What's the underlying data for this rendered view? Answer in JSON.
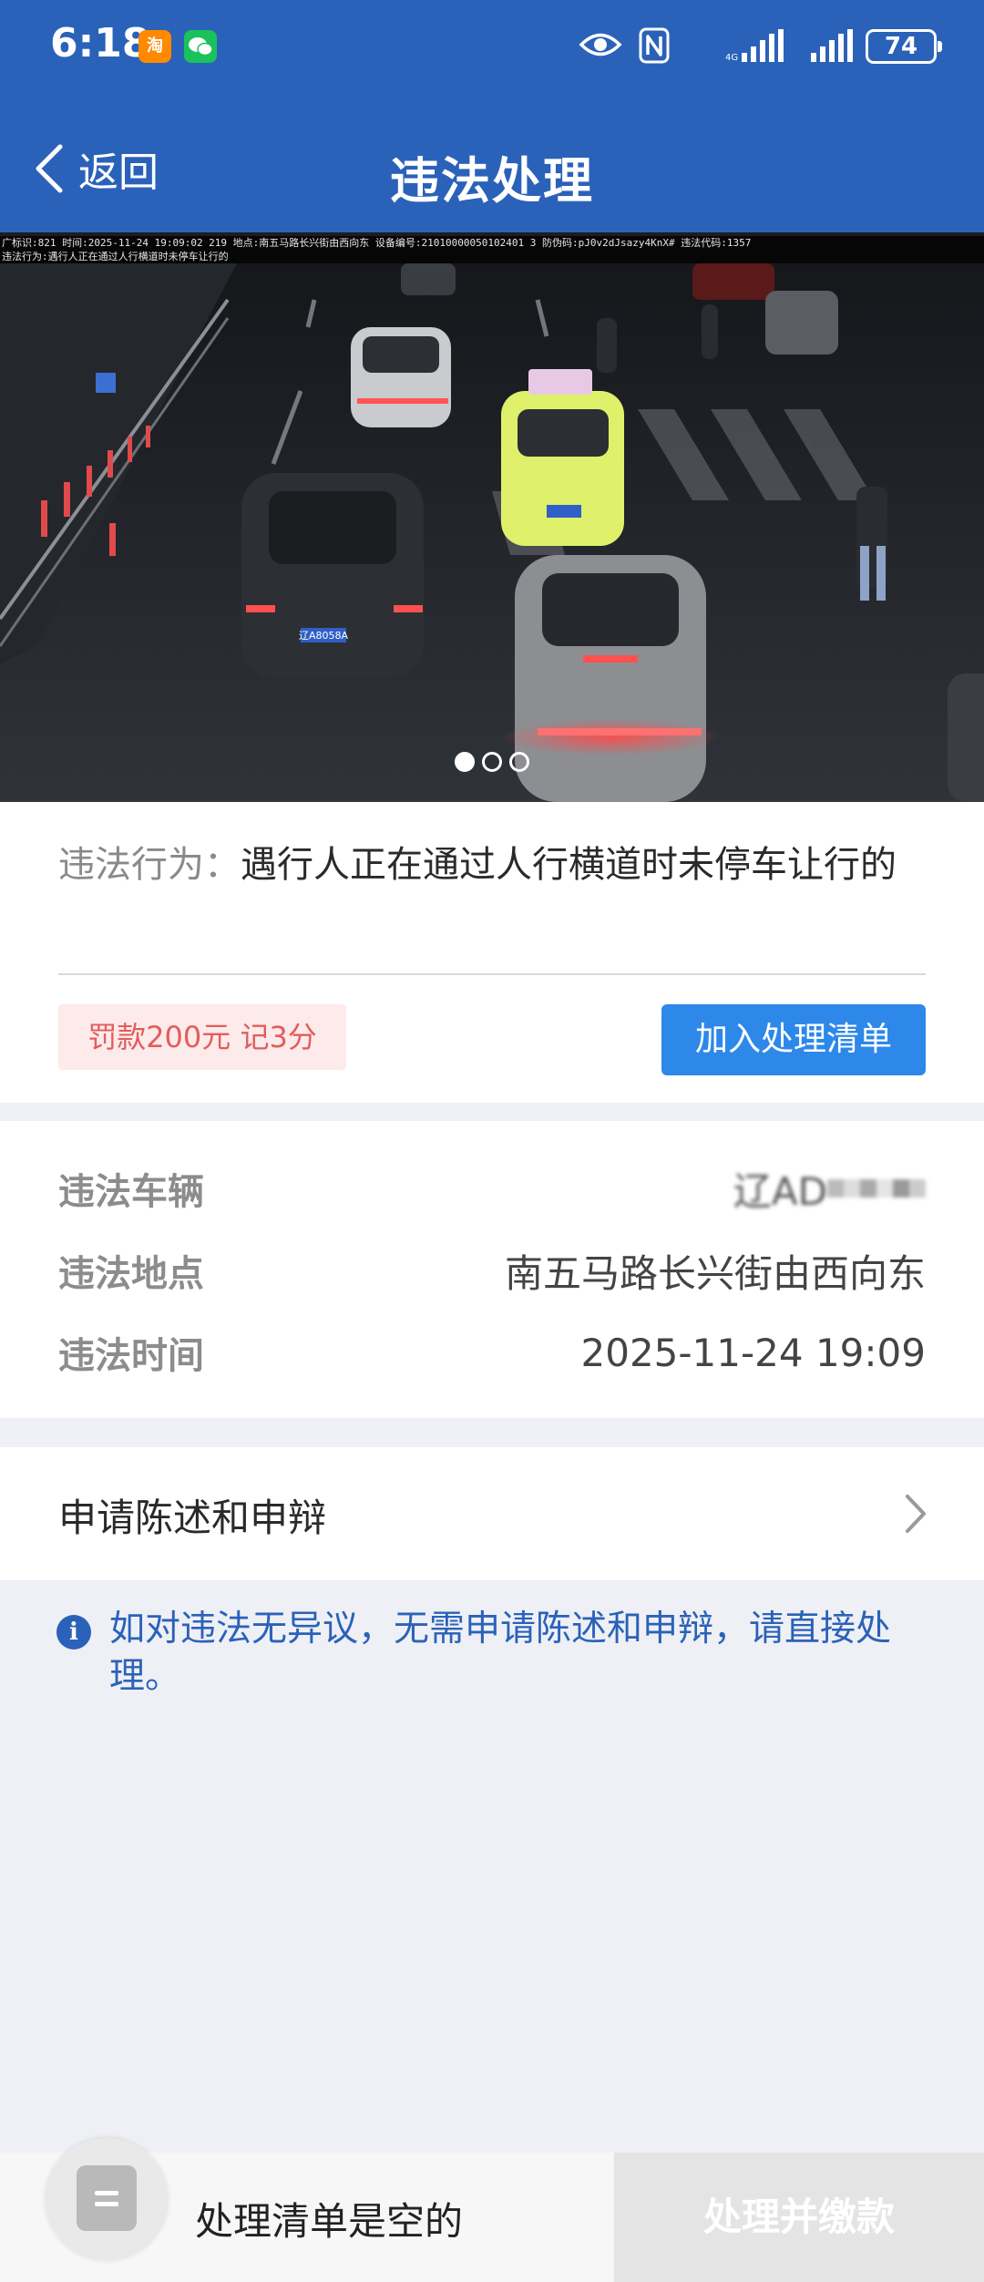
{
  "status_bar": {
    "time": "6:18",
    "battery": "74",
    "icons": [
      "taobao-icon",
      "wechat-icon",
      "eye-icon",
      "nfc-icon",
      "signal-icon",
      "signal-icon",
      "battery-icon"
    ]
  },
  "nav": {
    "back_label": "返回",
    "title": "违法处理"
  },
  "photo": {
    "caption_line1": "广标识:821 时间:2025-11-24 19:09:02 219 地点:南五马路长兴街由西向东 设备编号:21010000050102401 3 防伪码:pJ0v2dJsazy4KnX# 违法代码:1357",
    "caption_line2": "违法行为:遇行人正在通过人行横道时未停车让行的",
    "plate_text": "辽A8058A",
    "carousel_count": 3,
    "carousel_active": 0
  },
  "behavior": {
    "label": "违法行为：",
    "text": "遇行人正在通过人行横道时未停车让行的",
    "penalty": "罚款200元 记3分",
    "add_button": "加入处理清单"
  },
  "details": {
    "vehicle_label": "违法车辆",
    "vehicle_value_visible": "辽AD",
    "location_label": "违法地点",
    "location_value": "南五马路长兴街由西向东",
    "time_label": "违法时间",
    "time_value": "2025-11-24 19:09"
  },
  "appeal": {
    "label": "申请陈述和申辩"
  },
  "notice": {
    "text": "如对违法无异议，无需申请陈述和申辩，请直接处理。"
  },
  "bottom": {
    "empty_text": "处理清单是空的",
    "pay_button": "处理并缴款"
  },
  "colors": {
    "header_blue": "#2b62b9",
    "button_blue": "#2d88ea",
    "penalty_red": "#e25d5d",
    "penalty_bg": "#fdeaea",
    "disabled_gray": "#e4e4e4"
  }
}
